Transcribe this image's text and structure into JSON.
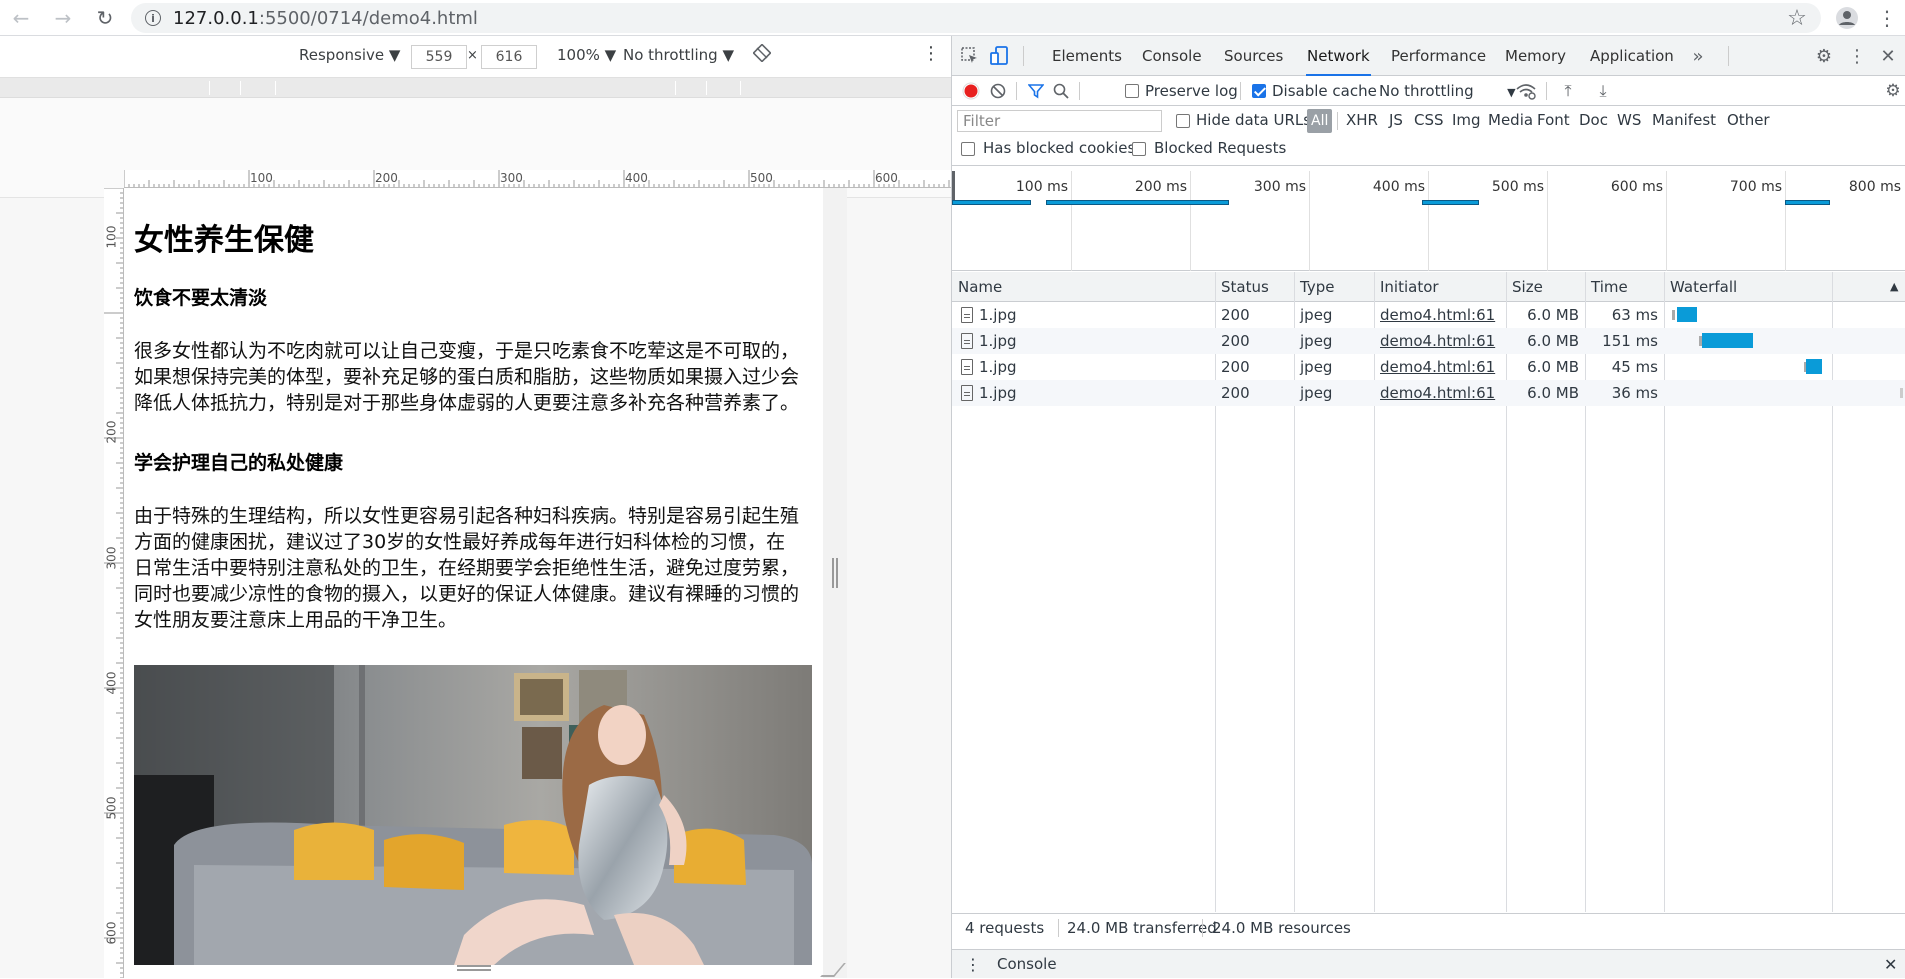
{
  "browser": {
    "url_host": "127.0.0.1",
    "url_path": ":5500/0714/demo4.html"
  },
  "device_toolbar": {
    "mode": "Responsive",
    "width": "559",
    "height": "616",
    "zoom": "100%",
    "throttling": "No throttling"
  },
  "rulers": {
    "h_ticks": [
      "100",
      "200",
      "300",
      "400",
      "500",
      "600"
    ],
    "v_ticks": [
      "100",
      "200",
      "300",
      "400",
      "500",
      "600"
    ]
  },
  "page": {
    "title": "女性养生保健",
    "sections": [
      {
        "heading": "饮食不要太清淡",
        "body": "很多女性都认为不吃肉就可以让自己变瘦，于是只吃素食不吃荤这是不可取的，如果想保持完美的体型，要补充足够的蛋白质和脂肪，这些物质如果摄入过少会降低人体抵抗力，特别是对于那些身体虚弱的人更要注意多补充各种营养素了。"
      },
      {
        "heading": "学会护理自己的私处健康",
        "body": "由于特殊的生理结构，所以女性更容易引起各种妇科疾病。特别是容易引起生殖方面的健康困扰，建议过了30岁的女性最好养成每年进行妇科体检的习惯，在日常生活中要特别注意私处的卫生，在经期要学会拒绝性生活，避免过度劳累，同时也要减少凉性的食物的摄入，以更好的保证人体健康。建议有裸睡的习惯的女性朋友要注意床上用品的干净卫生。"
      }
    ]
  },
  "devtools": {
    "tabs": [
      "Elements",
      "Console",
      "Sources",
      "Network",
      "Performance",
      "Memory",
      "Application"
    ],
    "active_tab": "Network",
    "toolbar": {
      "preserve_log": "Preserve log",
      "disable_cache": "Disable cache",
      "throttling": "No throttling"
    },
    "filter": {
      "placeholder": "Filter",
      "hide_data_urls": "Hide data URLs",
      "types": [
        "All",
        "XHR",
        "JS",
        "CSS",
        "Img",
        "Media",
        "Font",
        "Doc",
        "WS",
        "Manifest",
        "Other"
      ],
      "has_blocked_cookies": "Has blocked cookies",
      "blocked_requests": "Blocked Requests"
    },
    "overview_ticks": [
      "100 ms",
      "200 ms",
      "300 ms",
      "400 ms",
      "500 ms",
      "600 ms",
      "700 ms",
      "800 ms"
    ],
    "columns": [
      "Name",
      "Status",
      "Type",
      "Initiator",
      "Size",
      "Time",
      "Waterfall"
    ],
    "requests": [
      {
        "name": "1.jpg",
        "status": "200",
        "type": "jpeg",
        "initiator": "demo4.html:61",
        "size": "6.0 MB",
        "time": "63 ms"
      },
      {
        "name": "1.jpg",
        "status": "200",
        "type": "jpeg",
        "initiator": "demo4.html:61",
        "size": "6.0 MB",
        "time": "151 ms"
      },
      {
        "name": "1.jpg",
        "status": "200",
        "type": "jpeg",
        "initiator": "demo4.html:61",
        "size": "6.0 MB",
        "time": "45 ms"
      },
      {
        "name": "1.jpg",
        "status": "200",
        "type": "jpeg",
        "initiator": "demo4.html:61",
        "size": "6.0 MB",
        "time": "36 ms"
      }
    ],
    "summary": {
      "requests": "4 requests",
      "transferred": "24.0 MB transferred",
      "resources": "24.0 MB resources"
    },
    "drawer_label": "Console"
  },
  "colors": {
    "accent": "#1a73e8",
    "waterfall_bar": "#0a9bd8",
    "record": "#e8201f"
  }
}
